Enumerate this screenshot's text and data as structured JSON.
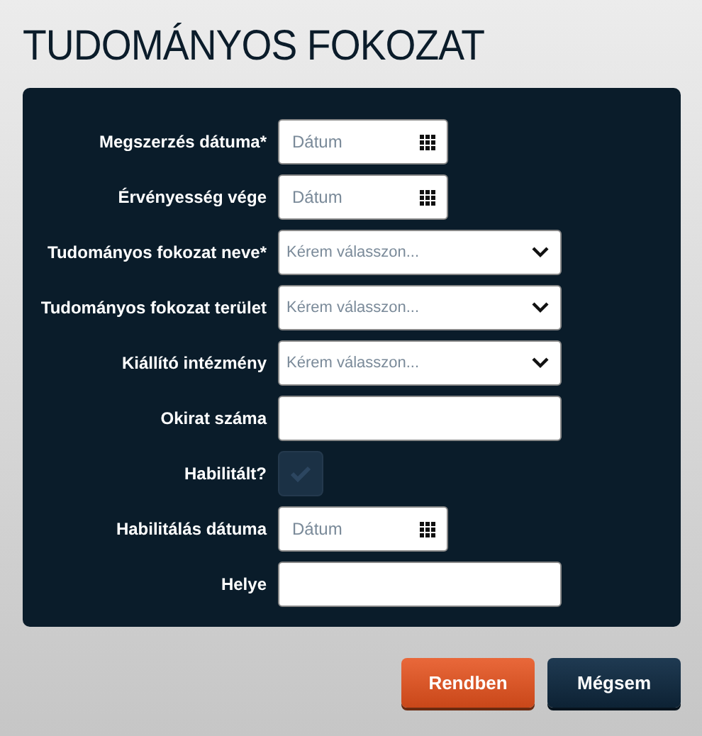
{
  "title": "TUDOMÁNYOS FOKOZAT",
  "fields": [
    {
      "kind": "date",
      "label": "Megszerzés dátuma*",
      "placeholder": "Dátum"
    },
    {
      "kind": "date",
      "label": "Érvényesség vége",
      "placeholder": "Dátum"
    },
    {
      "kind": "select",
      "label": "Tudományos fokozat neve*",
      "placeholder": "Kérem válasszon..."
    },
    {
      "kind": "select",
      "label": "Tudományos fokozat terület",
      "placeholder": "Kérem válasszon..."
    },
    {
      "kind": "select",
      "label": "Kiállító intézmény",
      "placeholder": "Kérem válasszon..."
    },
    {
      "kind": "text",
      "label": "Okirat száma"
    },
    {
      "kind": "checkbox",
      "label": "Habilitált?",
      "checked": false
    },
    {
      "kind": "date",
      "label": "Habilitálás dátuma",
      "placeholder": "Dátum"
    },
    {
      "kind": "text",
      "label": "Helye"
    }
  ],
  "buttons": [
    {
      "kind": "primary",
      "label": "Rendben"
    },
    {
      "kind": "secondary",
      "label": "Mégsem"
    }
  ]
}
